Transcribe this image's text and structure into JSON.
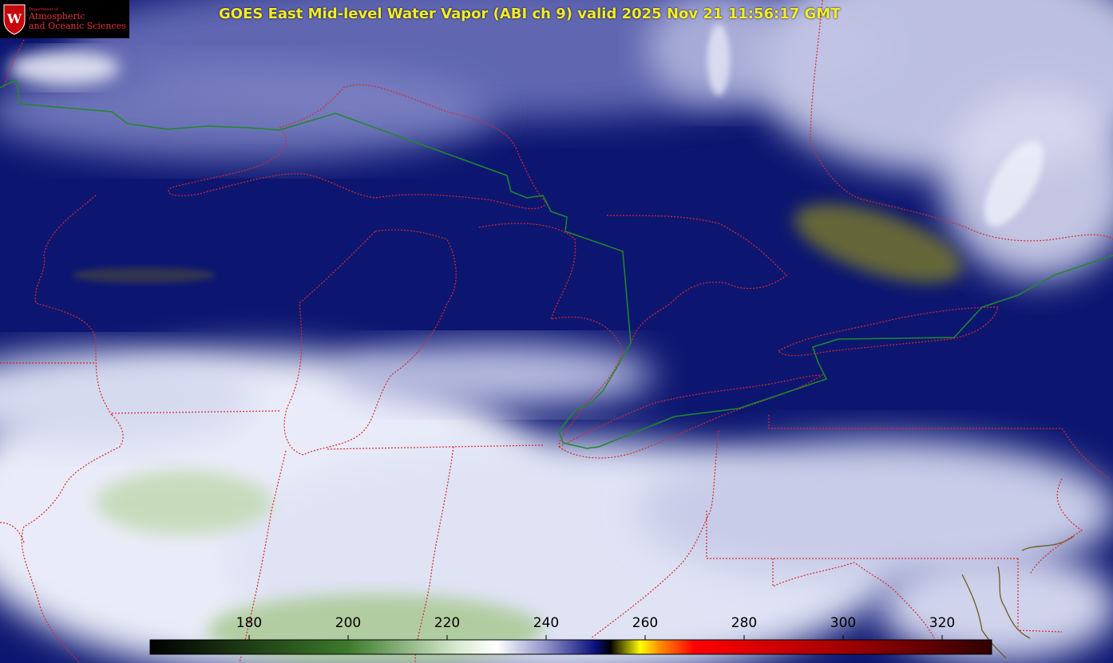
{
  "logo": {
    "department": "Department of",
    "line1": "Atmospheric",
    "line2": "and Oceanic Sciences",
    "seal_letter": "W"
  },
  "title": "GOES East Mid-level Water Vapor (ABI ch 9)  valid 2025 Nov 21 11:56:17 GMT",
  "colorbar": {
    "min": 160,
    "max": 330,
    "ticks": [
      "180",
      "200",
      "220",
      "240",
      "260",
      "280",
      "300",
      "320"
    ],
    "tick_values": [
      180,
      200,
      220,
      240,
      260,
      280,
      300,
      320
    ],
    "stops": [
      {
        "value": 160,
        "color": "#000000"
      },
      {
        "value": 200,
        "color": "#3c7a2a"
      },
      {
        "value": 222,
        "color": "#d8ead0"
      },
      {
        "value": 230,
        "color": "#ffffff"
      },
      {
        "value": 240,
        "color": "#8e92c8"
      },
      {
        "value": 250,
        "color": "#0a0f7a"
      },
      {
        "value": 253,
        "color": "#000000"
      },
      {
        "value": 259,
        "color": "#ffff00"
      },
      {
        "value": 263,
        "color": "#ff8c00"
      },
      {
        "value": 270,
        "color": "#ff0000"
      },
      {
        "value": 295,
        "color": "#b30000"
      },
      {
        "value": 330,
        "color": "#300000"
      }
    ]
  },
  "colors": {
    "boundary_state": "#e0262b",
    "boundary_national": "#1f8a2a",
    "coast": "#6b5a1a",
    "background_dry": "#0b1466",
    "background_moist": "#e8ecf8"
  }
}
